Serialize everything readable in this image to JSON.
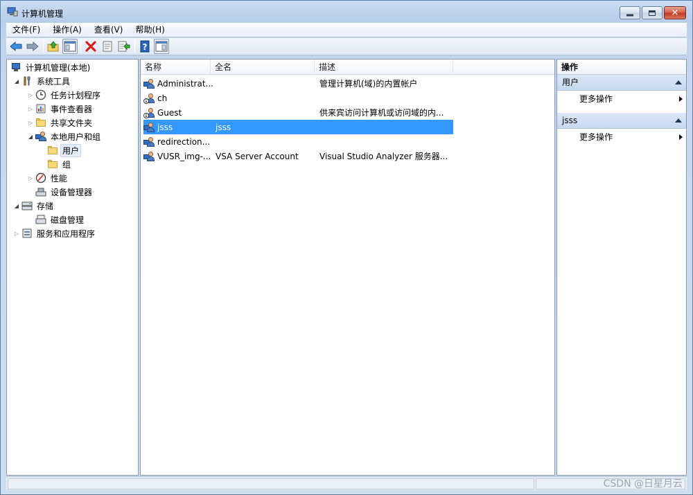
{
  "window": {
    "title": "计算机管理",
    "controls": {
      "minimize": "minimize",
      "maximize": "maximize",
      "close": "✕"
    }
  },
  "menu": [
    "文件(F)",
    "操作(A)",
    "查看(V)",
    "帮助(H)"
  ],
  "toolbar": {
    "buttons": [
      "back-arrow-icon",
      "forward-arrow-icon",
      "up-folder-icon",
      "show-hide-tree-icon",
      "delete-icon",
      "properties-icon",
      "export-list-icon",
      "help-icon",
      "show-hide-action-pane-icon"
    ]
  },
  "tree": {
    "root": "计算机管理(本地)",
    "system_tools": "系统工具",
    "task_scheduler": "任务计划程序",
    "event_viewer": "事件查看器",
    "shared_folders": "共享文件夹",
    "local_users_groups": "本地用户和组",
    "users": "用户",
    "groups": "组",
    "performance": "性能",
    "device_manager": "设备管理器",
    "storage": "存储",
    "disk_management": "磁盘管理",
    "services_apps": "服务和应用程序"
  },
  "list": {
    "columns": [
      "名称",
      "全名",
      "描述"
    ],
    "rows": [
      {
        "name": "Administrat...",
        "fullname": "",
        "desc": "管理计算机(域)的内置帐户",
        "disabled": false
      },
      {
        "name": "ch",
        "fullname": "",
        "desc": "",
        "disabled": true
      },
      {
        "name": "Guest",
        "fullname": "",
        "desc": "供来宾访问计算机或访问域的内...",
        "disabled": true
      },
      {
        "name": "jsss",
        "fullname": "jsss",
        "desc": "",
        "disabled": false,
        "selected": true
      },
      {
        "name": "redirection...",
        "fullname": "",
        "desc": "",
        "disabled": false
      },
      {
        "name": "VUSR_img-...",
        "fullname": "VSA Server Account",
        "desc": "Visual Studio Analyzer 服务器...",
        "disabled": false
      }
    ]
  },
  "actions": {
    "header": "操作",
    "section1": "用户",
    "section1_more": "更多操作",
    "section2": "jsss",
    "section2_more": "更多操作"
  },
  "watermark": "CSDN @日星月云"
}
